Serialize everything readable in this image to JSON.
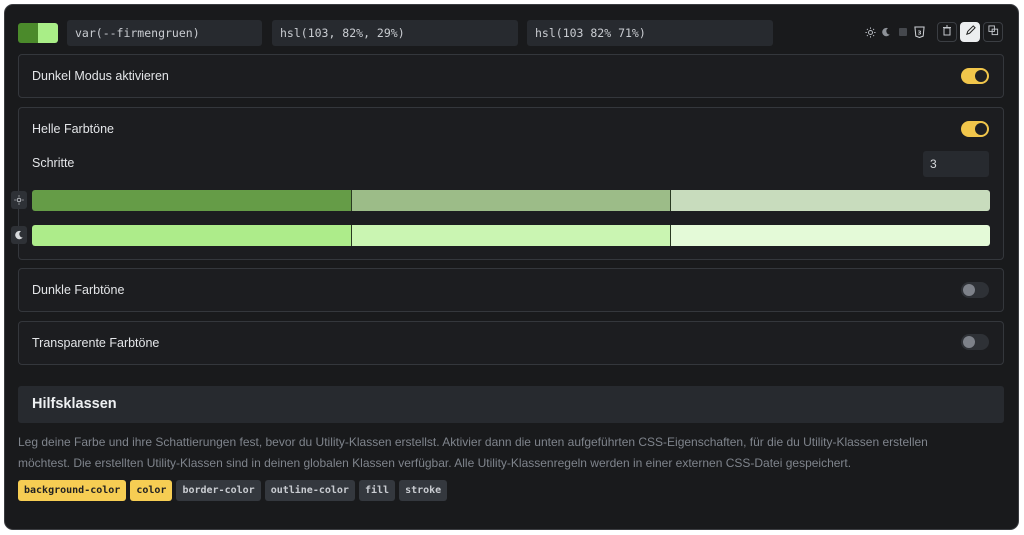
{
  "colors": {
    "swatch_left": "#4b8a2b",
    "swatch_right": "#a9ee87",
    "toggle_on": "#f1c64b",
    "chip_active": "#f6cd53"
  },
  "toolbar": {
    "variable_value": "var(--firmengruen)",
    "hsl_light_value": "hsl(103, 82%, 29%)",
    "hsl_dark_value": "hsl(103 82% 71%)",
    "icons": [
      "sun-icon",
      "moon-icon",
      "square-icon",
      "css3-icon",
      "trash-icon",
      "pencil-icon",
      "copy-icon"
    ]
  },
  "dark_mode": {
    "label": "Dunkel Modus aktivieren",
    "enabled": true
  },
  "light_tints": {
    "label": "Helle Farbtöne",
    "enabled": true,
    "steps_label": "Schritte",
    "steps_value": "3",
    "light_row": [
      "#659c47",
      "#9cbc88",
      "#c8dcbd"
    ],
    "dark_row": [
      "#adec8a",
      "#caf5b2",
      "#e4fad8"
    ]
  },
  "dark_tints": {
    "label": "Dunkle Farbtöne",
    "enabled": false
  },
  "transparent_tints": {
    "label": "Transparente Farbtöne",
    "enabled": false
  },
  "utility": {
    "title": "Hilfsklassen",
    "description": "Leg deine Farbe und ihre Schattierungen fest, bevor du Utility-Klassen erstellst. Aktivier dann die unten aufgeführten CSS-Eigenschaften, für die du Utility-Klassen erstellen möchtest. Die erstellten Utility-Klassen sind in deinen globalen Klassen verfügbar. Alle Utility-Klassenregeln werden in einer externen CSS-Datei gespeichert.",
    "chips": [
      {
        "label": "background-color",
        "active": true
      },
      {
        "label": "color",
        "active": true
      },
      {
        "label": "border-color",
        "active": false
      },
      {
        "label": "outline-color",
        "active": false
      },
      {
        "label": "fill",
        "active": false
      },
      {
        "label": "stroke",
        "active": false
      }
    ]
  }
}
